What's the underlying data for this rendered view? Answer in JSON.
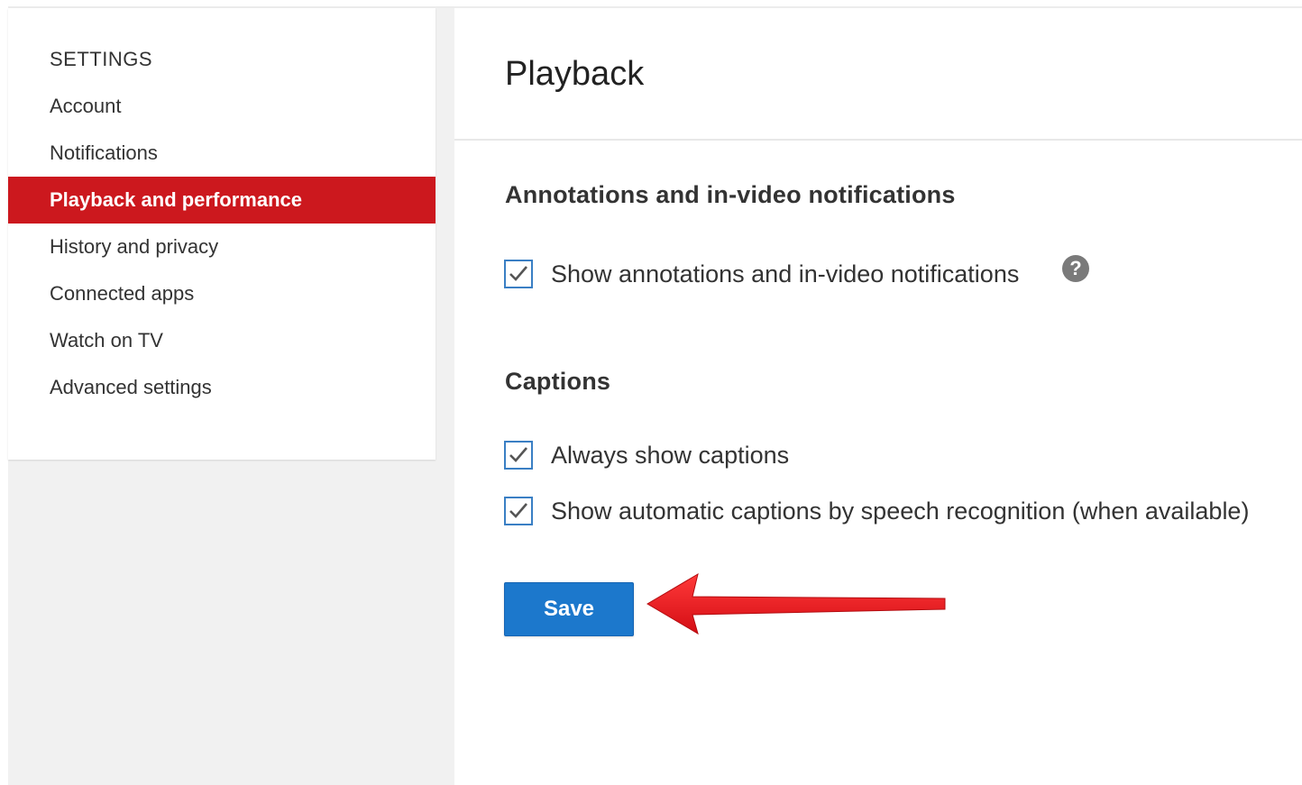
{
  "sidebar": {
    "heading": "SETTINGS",
    "items": [
      {
        "label": "Account",
        "active": false
      },
      {
        "label": "Notifications",
        "active": false
      },
      {
        "label": "Playback and performance",
        "active": true
      },
      {
        "label": "History and privacy",
        "active": false
      },
      {
        "label": "Connected apps",
        "active": false
      },
      {
        "label": "Watch on TV",
        "active": false
      },
      {
        "label": "Advanced settings",
        "active": false
      }
    ]
  },
  "main": {
    "title": "Playback",
    "sections": [
      {
        "heading": "Annotations and in-video notifications",
        "options": [
          {
            "label": "Show annotations and in-video notifications",
            "checked": true,
            "help_icon": "question-icon"
          }
        ]
      },
      {
        "heading": "Captions",
        "options": [
          {
            "label": "Always show captions",
            "checked": true
          },
          {
            "label": "Show automatic captions by speech recognition (when available)",
            "checked": true
          }
        ]
      }
    ],
    "save_label": "Save",
    "help_glyph": "?"
  },
  "colors": {
    "accent_red": "#cc181e",
    "button_blue": "#1c78cc",
    "checkbox_blue": "#3a7fc4",
    "arrow_red": "#e8141c"
  }
}
